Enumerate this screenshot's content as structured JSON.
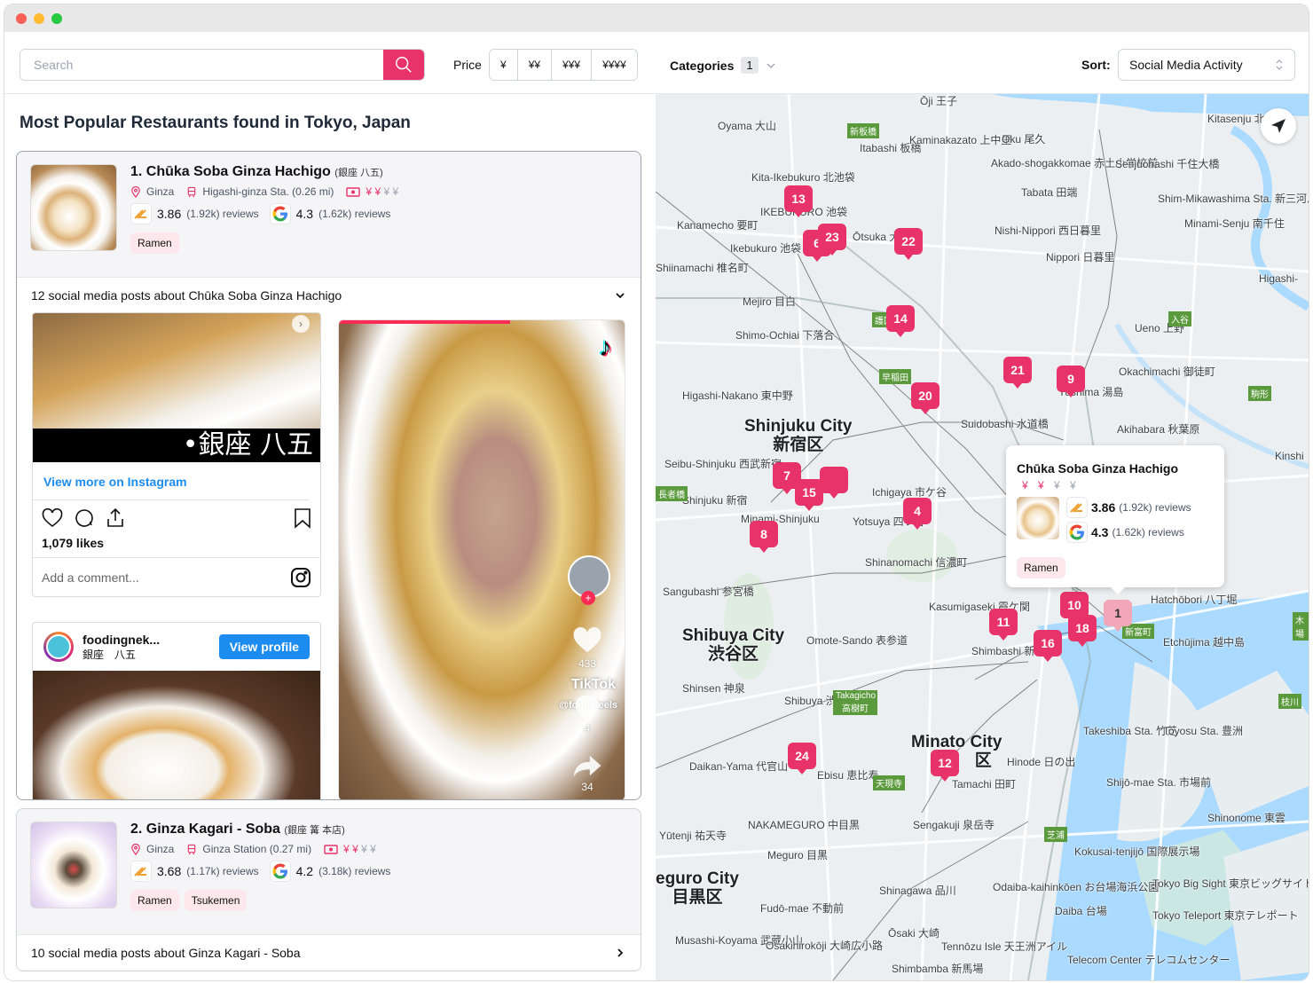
{
  "window": {
    "controls": [
      "close",
      "minimize",
      "maximize"
    ]
  },
  "toolbar": {
    "search_placeholder": "Search",
    "search_icon": "search-icon",
    "price_label": "Price",
    "price_options": [
      "¥",
      "¥¥",
      "¥¥¥",
      "¥¥¥¥"
    ],
    "categories_label": "Categories",
    "categories_count": "1",
    "sort_label": "Sort:",
    "sort_value": "Social Media Activity"
  },
  "heading": "Most Popular Restaurants found in Tokyo, Japan",
  "restaurants": [
    {
      "rank_name": "1. Chūka Soba Ginza Hachigo",
      "jp_name": "(銀座 八五)",
      "area": "Ginza",
      "station": "Higashi-ginza Sta. (0.26 mi)",
      "price_level": 2,
      "price_max": 4,
      "tabelog_rating": "3.86",
      "tabelog_reviews": "(1.92k) reviews",
      "google_rating": "4.3",
      "google_reviews": "(1.62k) reviews",
      "tags": [
        "Ramen"
      ],
      "posts_label": "12 social media posts about Chūka Soba Ginza Hachigo",
      "posts_expanded": true,
      "instagram_post": {
        "image_caption": "•銀座 八五",
        "view_more": "View more on Instagram",
        "likes": "1,079 likes",
        "comment_placeholder": "Add a comment..."
      },
      "instagram_post_2": {
        "username": "foodingnek...",
        "location": "銀座　八五",
        "view_profile": "View profile"
      },
      "tiktok_post": {
        "progress": 0.6,
        "likes": "433",
        "comments": "4",
        "shares": "34",
        "brand": "TikTok",
        "handle": "@food_feels"
      }
    },
    {
      "rank_name": "2. Ginza Kagari - Soba",
      "jp_name": "(銀座 篝 本店)",
      "area": "Ginza",
      "station": "Ginza Station (0.27 mi)",
      "price_level": 2,
      "price_max": 4,
      "tabelog_rating": "3.68",
      "tabelog_reviews": "(1.17k) reviews",
      "google_rating": "4.2",
      "google_reviews": "(3.18k) reviews",
      "tags": [
        "Ramen",
        "Tsukemen"
      ],
      "posts_label": "10 social media posts about Ginza Kagari - Soba",
      "posts_expanded": false
    }
  ],
  "map": {
    "colors": {
      "pin": "#e8336a",
      "pin_active": "#f2a7b8",
      "water": "#aadaff",
      "land": "#eceff1"
    },
    "pins": [
      "13",
      "6",
      "23",
      "22",
      "14",
      "21",
      "9",
      "20",
      "7",
      "15",
      "4",
      "8",
      "10",
      "1",
      "11",
      "18",
      "16",
      "24",
      "12"
    ],
    "labels": {
      "shinjuku_en": "Shinjuku City",
      "shinjuku_jp": "新宿区",
      "shibuya_en": "Shibuya City",
      "shibuya_jp": "渋谷区",
      "minato_en": "Minato City",
      "minato_jp": "区",
      "meguro_en": "eguro City",
      "meguro_jp": "目黒区",
      "oyama": "Oyama 大山",
      "itabashi": "Itabashi 板橋",
      "kita_ikebukuro": "Kita-Ikebukuro 北池袋",
      "ikebukuro_area": "IKEBUKURO 池袋",
      "kanamecho": "Kanamecho 要町",
      "ikebukuro": "Ikebukuro 池袋",
      "otsuka": "Ōtsuka 大塚",
      "shiinamachi": "Shiinamachi 椎名町",
      "mejiro": "Mejiro 目白",
      "oji": "Ōji 王子",
      "kaminakazato": "Kaminakazato 上中里",
      "oku": "Oku 尾久",
      "akado": "Akado-shogakkomae 赤土小学校前",
      "tabata": "Tabata 田端",
      "nishi_nippori": "Nishi-Nippori 西日暮里",
      "nippori": "Nippori 日暮里",
      "kitasenju": "Kitasenju 北千住",
      "senjuohashi": "Senjuohashi 千住大橋",
      "shim_mikawashima": "Shim-Mikawashima Sta. 新三河島",
      "minami_senju": "Minami-Senju 南千住",
      "ueno": "Ueno 上野",
      "okachimachi": "Okachimachi 御徒町",
      "yushima": "Yushima 湯島",
      "akihabara": "Akihabara 秋葉原",
      "suidobashi": "Suidobashi 水道橋",
      "shimo_ochiai": "Shimo-Ochiai 下落合",
      "higashi_nakano": "Higashi-Nakano 東中野",
      "seibu_shinjuku": "Seibu-Shinjuku 西武新宿",
      "shinjuku": "Shinjuku 新宿",
      "minami_shinjuku": "Minami-Shinjuku",
      "ichigaya": "Ichigaya 市ケ谷",
      "yotsuya": "Yotsuya 四ツ谷",
      "shinanomachi": "Shinanomachi 信濃町",
      "sangubashi": "Sangubashi 参宮橋",
      "omote_sando": "Omote-Sando 表参道",
      "shinsen": "Shinsen 神泉",
      "shibuya": "Shibuya 渋谷",
      "daikan_yama": "Daikan-Yama 代官山",
      "ebisu": "Ebisu 恵比寿",
      "kasumigaseki": "Kasumigaseki 霞ケ関",
      "shimbashi": "Shimbashi 新橋",
      "hatchobori": "Hatchōbori 八丁堀",
      "etchujima": "Etchūjima 越中島",
      "takeshiba": "Takeshiba Sta. 竹芝",
      "toyosu": "Toyosu Sta. 豊洲",
      "hinode": "Hinode 日の出",
      "tamachi": "Tamachi 田町",
      "shijo_mae": "Shijō-mae Sta. 市場前",
      "naka_meguro": "NAKAMEGURO 中目黒",
      "yutenji": "Yūtenji 祐天寺",
      "meguro": "Meguro 目黒",
      "sengakuji": "Sengakuji 泉岳寺",
      "shinagawa": "Shinagawa 品川",
      "fudo_mae": "Fudō-mae 不動前",
      "osaki": "Ōsaki 大崎",
      "musashi_koyama": "Musashi-Koyama 武蔵小山",
      "osakihirokoji": "Osakihirokōji 大崎広小路",
      "tennozu": "Tennōzu Isle 天王洲アイル",
      "shimbamba": "Shimbamba 新馬場",
      "shinonome": "Shinonome 東雲",
      "kokusai": "Kokusai-tenjijō 国際展示場",
      "odaiba": "Odaiba-kaihinkōen お台場海浜公園",
      "daiba": "Daiba 台場",
      "big_sight": "Tokyo Big Sight 東京ビッグサイト",
      "teleport": "Tokyo Teleport 東京テレポート",
      "telecom": "Telecom Center テレコムセンター",
      "higashi": "Higashi-",
      "kinshi": "Kinshi"
    },
    "stations_green": [
      "新板橋",
      "護国",
      "早稲田",
      "長者橋",
      "Takagicho 高樹町",
      "天現寺",
      "芝浦",
      "新富町",
      "入谷",
      "駒形",
      "枝川",
      "木場"
    ],
    "popup": {
      "title": "Chūka Soba Ginza Hachigo",
      "price_level": 2,
      "price_max": 4,
      "tabelog_rating": "3.86",
      "tabelog_reviews": "(1.92k) reviews",
      "google_rating": "4.3",
      "google_reviews": "(1.62k) reviews",
      "tag": "Ramen"
    }
  }
}
